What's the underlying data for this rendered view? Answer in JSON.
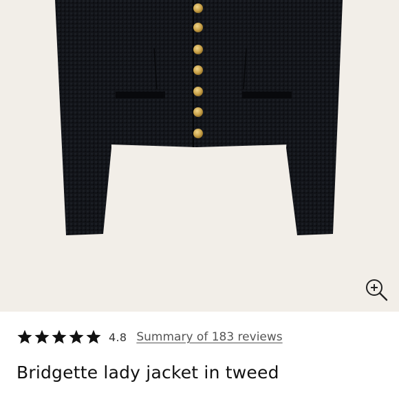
{
  "product": {
    "rating": "4.8",
    "stars_filled": 5,
    "reviews_link": "Summary of 183 reviews",
    "title": "Bridgette lady jacket in tweed"
  },
  "icons": {
    "zoom": "zoom-in-icon",
    "star": "star-icon"
  },
  "colors": {
    "photo_background": "#f2eee8",
    "jacket": "#101216",
    "buttons": "#c9a24a",
    "star": "#111111",
    "link": "#555555"
  }
}
